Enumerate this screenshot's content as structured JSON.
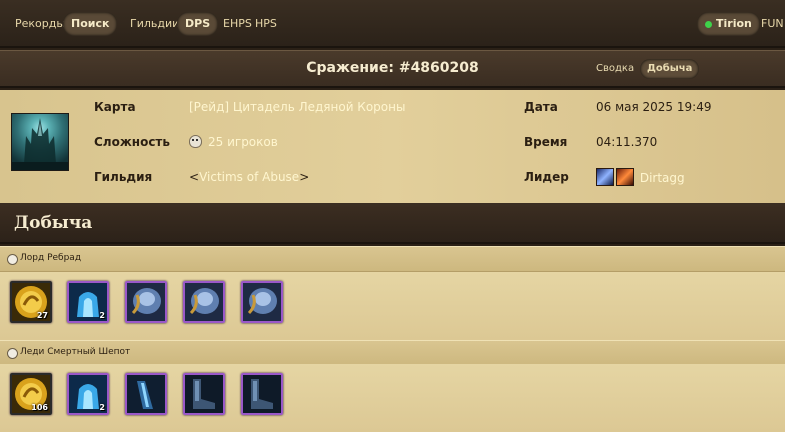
{
  "nav": {
    "items": [
      {
        "label": "Рекорды",
        "active": false
      },
      {
        "label": "Поиск",
        "active": true
      },
      {
        "label": "Гильдии",
        "active": false
      },
      {
        "label": "DPS",
        "active": true
      },
      {
        "label": "EHPS",
        "active": false
      },
      {
        "label": "HPS",
        "active": false
      }
    ],
    "server": "Tirion",
    "server_status_color": "#3fd34a",
    "realm_type": "FUN"
  },
  "battle": {
    "title": "Сражение: #4860208",
    "tabs": [
      {
        "label": "Сводка",
        "active": false
      },
      {
        "label": "Добыча",
        "active": true
      }
    ]
  },
  "info": {
    "map_label": "Карта",
    "map_value": "[Рейд] Цитадель Ледяной Короны",
    "difficulty_label": "Сложность",
    "difficulty_value": "25 игроков",
    "guild_label": "Гильдия",
    "guild_open": "<",
    "guild_value": "Victims of Abuse",
    "guild_close": ">",
    "date_label": "Дата",
    "date_value": "06 мая 2025 19:49",
    "time_label": "Время",
    "time_value": "04:11.370",
    "leader_label": "Лидер",
    "leader_value": "Dirtagg",
    "leader_icons": [
      "race-icon",
      "class-icon"
    ]
  },
  "loot": {
    "title": "Добыча",
    "bosses": [
      {
        "name": "Лорд Ребрад",
        "items": [
          {
            "icon": "gold-emblem-icon",
            "qty": "27"
          },
          {
            "icon": "frost-token-icon",
            "qty": "2"
          },
          {
            "icon": "armor-plate-icon",
            "qty": ""
          },
          {
            "icon": "armor-plate-icon",
            "qty": ""
          },
          {
            "icon": "armor-plate-icon",
            "qty": ""
          }
        ]
      },
      {
        "name": "Леди Смертный Шепот",
        "items": [
          {
            "icon": "gold-emblem-icon",
            "qty": "106"
          },
          {
            "icon": "frost-token-icon",
            "qty": "2"
          },
          {
            "icon": "bracers-icon",
            "qty": ""
          },
          {
            "icon": "boots-icon",
            "qty": ""
          },
          {
            "icon": "boots-icon",
            "qty": ""
          }
        ]
      }
    ]
  },
  "colors": {
    "epic_border": "#9a58c8",
    "link_text": "#fff6cf",
    "panel_bg": "#e2cf9b"
  }
}
